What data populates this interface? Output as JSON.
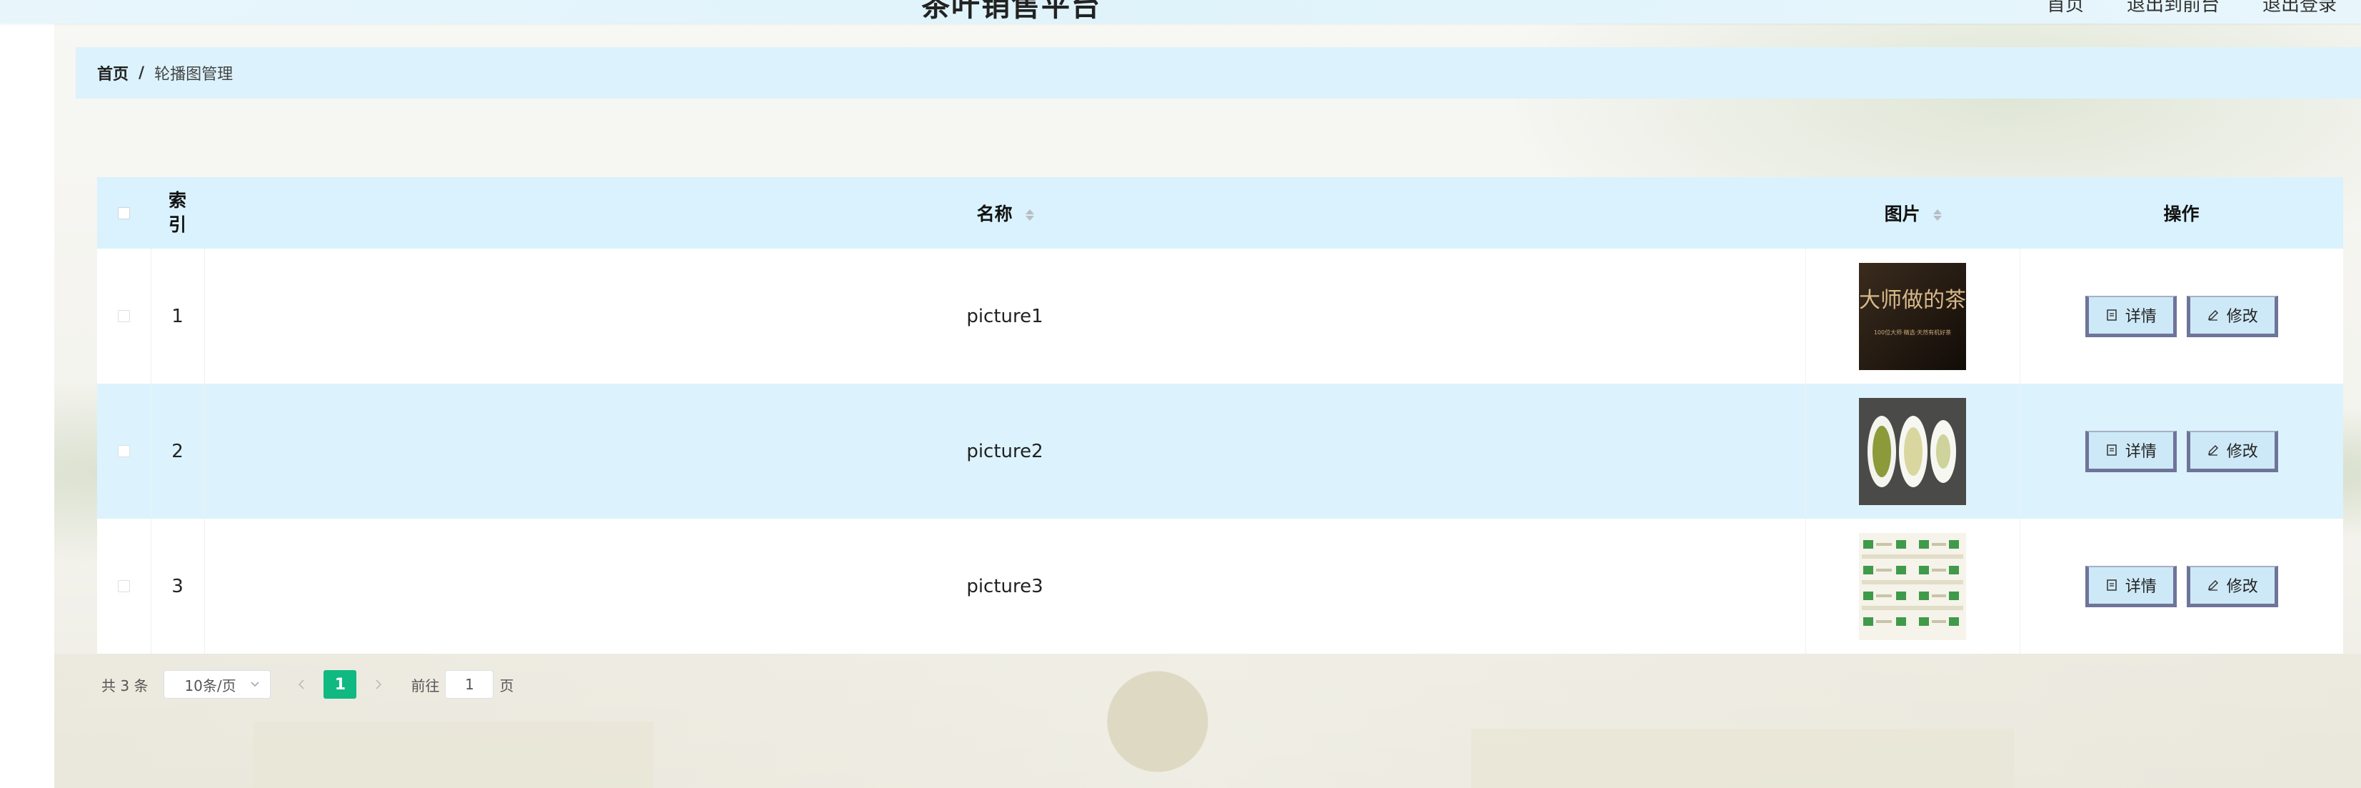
{
  "header": {
    "site_title": "茶叶销售平台",
    "links": [
      "首页",
      "退出到前台",
      "退出登录"
    ]
  },
  "breadcrumb": {
    "home": "首页",
    "separator": "/",
    "current": "轮播图管理"
  },
  "table": {
    "columns": {
      "index": "索引",
      "name": "名称",
      "image": "图片",
      "actions": "操作"
    },
    "rows": [
      {
        "index": "1",
        "name": "picture1"
      },
      {
        "index": "2",
        "name": "picture2"
      },
      {
        "index": "3",
        "name": "picture3"
      }
    ],
    "detail_label": "详情",
    "edit_label": "修改",
    "image1_text": {
      "title": "大师做的茶",
      "subtitle": "100位大师·精选·天然有机好茶"
    }
  },
  "pagination": {
    "total": "共 3 条",
    "page_size": "10条/页",
    "current_page": "1",
    "goto_prefix": "前往",
    "goto_value": "1",
    "goto_suffix": "页"
  },
  "colors": {
    "accent_green": "#10b981",
    "header_blue": "#d9f2fd",
    "button_border": "#6f7499"
  }
}
